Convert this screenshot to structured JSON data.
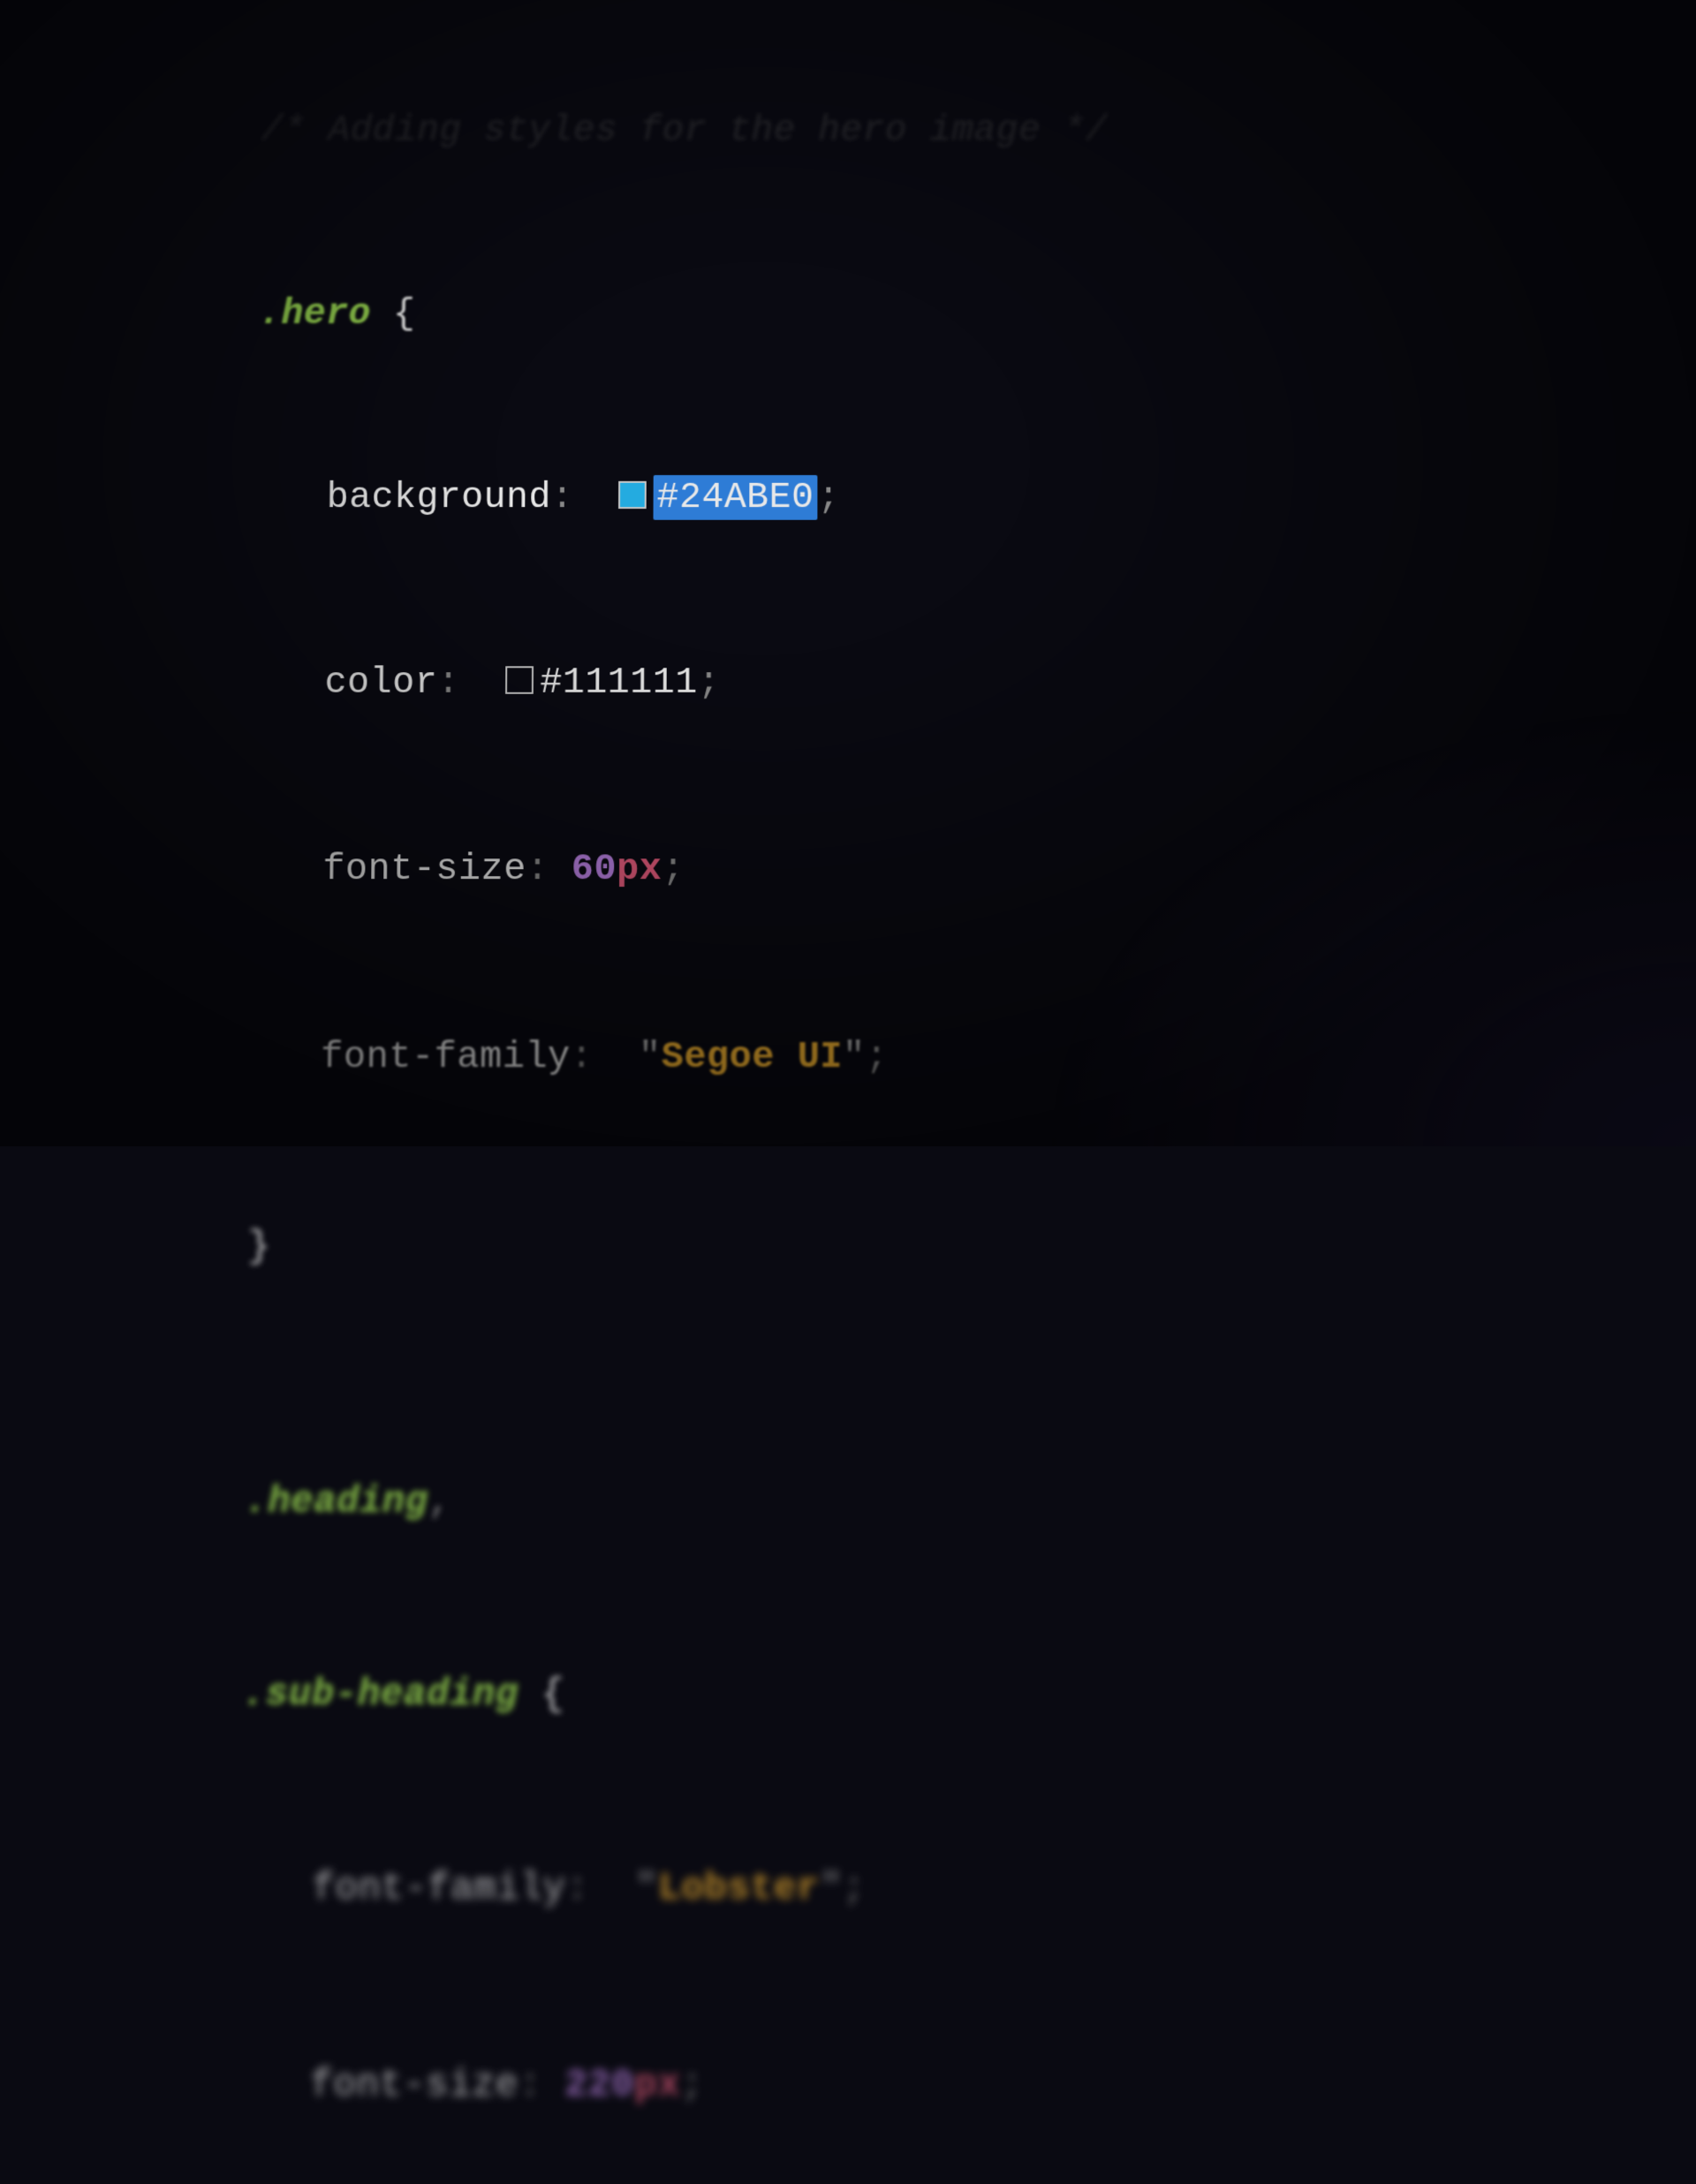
{
  "code": {
    "comment": "/* Adding styles for the hero image */",
    "rule1": {
      "selector": ".hero",
      "brace_open": "{",
      "brace_close": "}",
      "decl1": {
        "prop": "background",
        "colon": ":",
        "value": "#24ABE0",
        "swatch_color": "#24ABE0",
        "semicolon": ";"
      },
      "decl2": {
        "prop": "color",
        "colon": ":",
        "value": "#111111",
        "semicolon": ";"
      },
      "decl3": {
        "prop": "font-size",
        "colon": ":",
        "number": "60",
        "unit": "px",
        "semicolon": ";"
      },
      "decl4": {
        "prop": "font-family",
        "colon": ":",
        "quote": "\"",
        "string": "Segoe UI",
        "semicolon": ";"
      }
    },
    "rule2": {
      "selector1": ".heading",
      "comma": ",",
      "selector2": ".sub-heading",
      "brace_open": "{",
      "decl1": {
        "prop": "font-family",
        "colon": ":",
        "quote": "\"",
        "string": "Lobster",
        "semicolon": ";"
      },
      "decl2": {
        "prop": "font-size",
        "colon": ":",
        "number": "220",
        "unit": "px",
        "semicolon": ";"
      }
    }
  }
}
